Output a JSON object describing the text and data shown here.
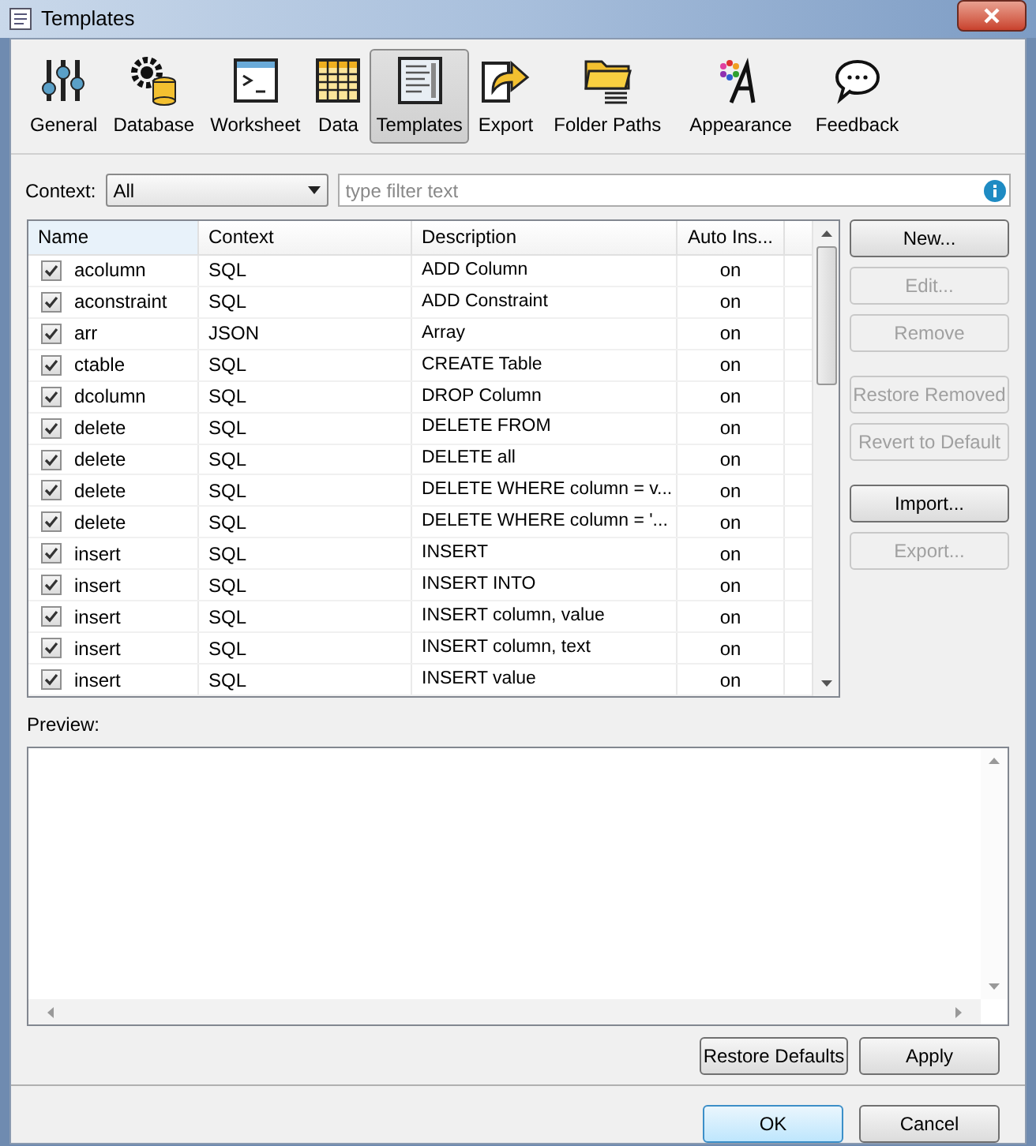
{
  "window": {
    "title": "Templates"
  },
  "tabs": [
    {
      "label": "General",
      "selected": false
    },
    {
      "label": "Database",
      "selected": false
    },
    {
      "label": "Worksheet",
      "selected": false
    },
    {
      "label": "Data",
      "selected": false
    },
    {
      "label": "Templates",
      "selected": true
    },
    {
      "label": "Export",
      "selected": false
    },
    {
      "label": "Folder Paths",
      "selected": false
    },
    {
      "label": "Appearance",
      "selected": false
    },
    {
      "label": "Feedback",
      "selected": false
    }
  ],
  "context": {
    "label": "Context:",
    "value": "All"
  },
  "filter": {
    "placeholder": "type filter text"
  },
  "table": {
    "columns": [
      "Name",
      "Context",
      "Description",
      "Auto Ins..."
    ],
    "rows": [
      {
        "checked": true,
        "name": "acolumn",
        "context": "SQL",
        "description": "ADD Column",
        "auto": "on"
      },
      {
        "checked": true,
        "name": "aconstraint",
        "context": "SQL",
        "description": "ADD Constraint",
        "auto": "on"
      },
      {
        "checked": true,
        "name": "arr",
        "context": "JSON",
        "description": "Array",
        "auto": "on"
      },
      {
        "checked": true,
        "name": "ctable",
        "context": "SQL",
        "description": "CREATE Table",
        "auto": "on"
      },
      {
        "checked": true,
        "name": "dcolumn",
        "context": "SQL",
        "description": "DROP Column",
        "auto": "on"
      },
      {
        "checked": true,
        "name": "delete",
        "context": "SQL",
        "description": "DELETE FROM",
        "auto": "on"
      },
      {
        "checked": true,
        "name": "delete",
        "context": "SQL",
        "description": "DELETE all",
        "auto": "on"
      },
      {
        "checked": true,
        "name": "delete",
        "context": "SQL",
        "description": "DELETE WHERE column = v...",
        "auto": "on"
      },
      {
        "checked": true,
        "name": "delete",
        "context": "SQL",
        "description": "DELETE WHERE column = '...",
        "auto": "on"
      },
      {
        "checked": true,
        "name": "insert",
        "context": "SQL",
        "description": "INSERT",
        "auto": "on"
      },
      {
        "checked": true,
        "name": "insert",
        "context": "SQL",
        "description": "INSERT INTO",
        "auto": "on"
      },
      {
        "checked": true,
        "name": "insert",
        "context": "SQL",
        "description": "INSERT column, value",
        "auto": "on"
      },
      {
        "checked": true,
        "name": "insert",
        "context": "SQL",
        "description": "INSERT column, text",
        "auto": "on"
      },
      {
        "checked": true,
        "name": "insert",
        "context": "SQL",
        "description": "INSERT value",
        "auto": "on"
      }
    ]
  },
  "side_buttons": [
    {
      "label": "New...",
      "disabled": false
    },
    {
      "label": "Edit...",
      "disabled": true
    },
    {
      "label": "Remove",
      "disabled": true
    },
    {
      "label": "Restore Removed",
      "disabled": true
    },
    {
      "label": "Revert to Default",
      "disabled": true
    },
    {
      "label": "Import...",
      "disabled": false
    },
    {
      "label": "Export...",
      "disabled": true
    }
  ],
  "preview": {
    "label": "Preview:"
  },
  "page_buttons": [
    "Restore Defaults",
    "Apply"
  ],
  "dialog_buttons": [
    {
      "label": "OK",
      "default": true
    },
    {
      "label": "Cancel",
      "default": false
    }
  ]
}
